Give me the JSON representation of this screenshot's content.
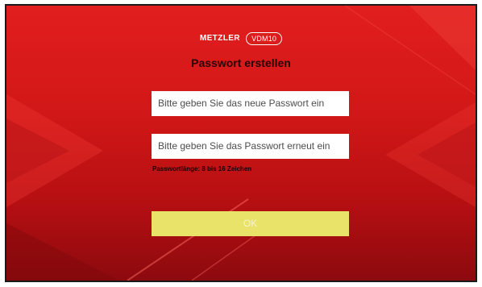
{
  "logo": {
    "brand": "METZLER",
    "model": "VDM10"
  },
  "title": "Passwort erstellen",
  "new_password_field": {
    "value": "",
    "placeholder": "Bitte geben Sie das neue Passwort ein"
  },
  "confirm_password_field": {
    "value": "",
    "placeholder": "Bitte geben Sie das Passwort erneut ein"
  },
  "hint": "Passwortlänge: 8 bis 16 Zeichen",
  "ok_button": {
    "label": "OK",
    "enabled": false
  },
  "colors": {
    "background": "#d11717",
    "button": "#e9e36a",
    "input": "#ffffff"
  }
}
